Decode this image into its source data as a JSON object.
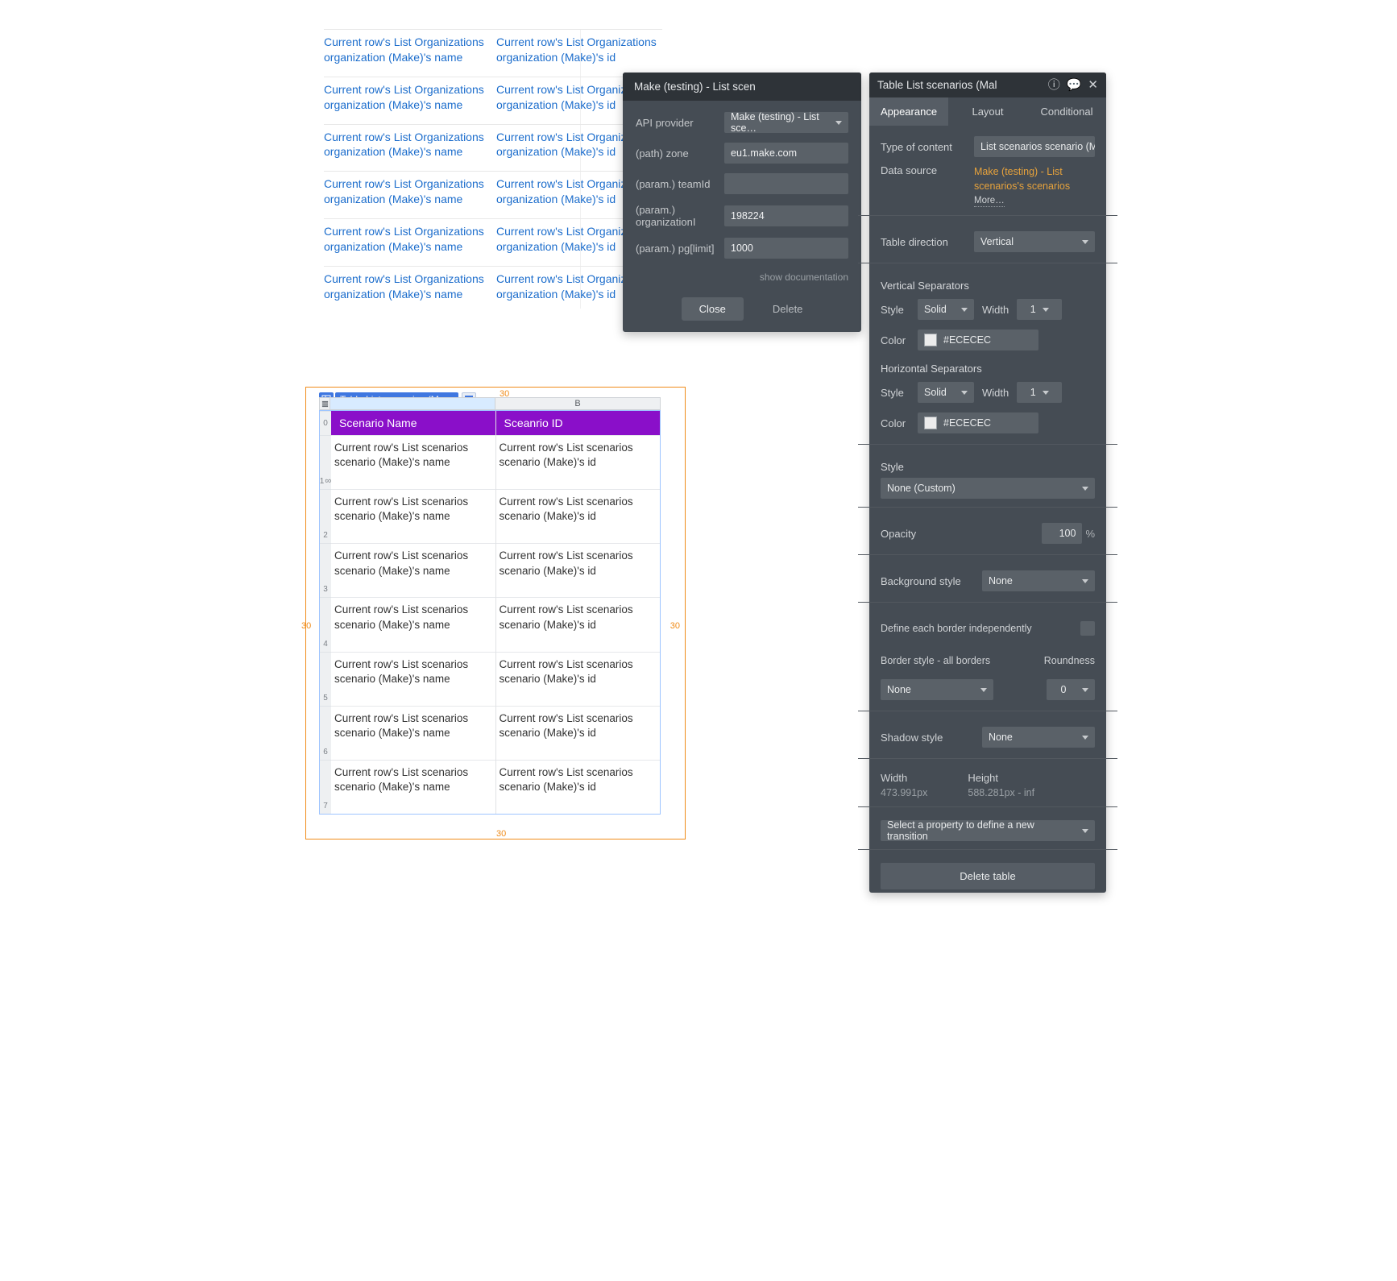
{
  "org_table": {
    "rows": [
      {
        "a": "Current row's List Organizations organization (Make)'s name",
        "b": "Current row's List Organizations organization (Make)'s id"
      },
      {
        "a": "Current row's List Organizations organization (Make)'s name",
        "b": "Current row's List Organizations organization (Make)'s id"
      },
      {
        "a": "Current row's List Organizations organization (Make)'s name",
        "b": "Current row's List Organizations organization (Make)'s id"
      },
      {
        "a": "Current row's List Organizations organization (Make)'s name",
        "b": "Current row's List Organizations organization (Make)'s id"
      },
      {
        "a": "Current row's List Organizations organization (Make)'s name",
        "b": "Current row's List Organizations organization (Make)'s id"
      },
      {
        "a": "Current row's List Organizations organization (Make)'s name",
        "b": "Current row's List Organizations organization (Make)'s id"
      }
    ]
  },
  "modal": {
    "title": "Make (testing) - List scen",
    "fields": {
      "api_provider": {
        "label": "API provider",
        "value": "Make (testing) - List sce…"
      },
      "zone": {
        "label": "(path) zone",
        "value": "eu1.make.com"
      },
      "team": {
        "label": "(param.) teamId",
        "value": ""
      },
      "org": {
        "label": "(param.) organizationI",
        "value": "198224"
      },
      "pg": {
        "label": "(param.) pg[limit]",
        "value": "1000"
      }
    },
    "doc_link": "show documentation",
    "close": "Close",
    "delete": "Delete"
  },
  "inspector": {
    "title": "Table List scenarios (Mal",
    "tabs": {
      "appearance": "Appearance",
      "layout": "Layout",
      "conditional": "Conditional"
    },
    "type_label": "Type of content",
    "type_value": "List scenarios scenario (Make",
    "ds_label": "Data source",
    "ds_value": "Make (testing) - List scenarios's scenarios",
    "ds_more": "More…",
    "dir_label": "Table direction",
    "dir_value": "Vertical",
    "vsep": "Vertical Separators",
    "hsep": "Horizontal Separators",
    "style_label": "Style",
    "style_value": "Solid",
    "width_label": "Width",
    "width_value": "1",
    "color_label": "Color",
    "color_value": "#ECECEC",
    "style2_value": "None (Custom)",
    "opacity_label": "Opacity",
    "opacity_value": "100",
    "bg_label": "Background style",
    "bg_value": "None",
    "border_indep": "Define each border independently",
    "border_all": "Border style - all borders",
    "border_value": "None",
    "round_label": "Roundness",
    "round_value": "0",
    "shadow_label": "Shadow style",
    "shadow_value": "None",
    "w_label": "Width",
    "w_value": "473.991px",
    "h_label": "Height",
    "h_value": "588.281px - inf",
    "transition": "Select a property to define a new transition",
    "delete_table": "Delete table"
  },
  "scenarios": {
    "chip": "Table List scenarios (Ma…",
    "colB": "B",
    "head_a": "Scenario Name",
    "head_b": "Sceanrio ID",
    "cell_a": "Current row's List scenarios scenario (Make)'s name",
    "cell_b": "Current row's List scenarios scenario (Make)'s id",
    "margin": "30"
  }
}
